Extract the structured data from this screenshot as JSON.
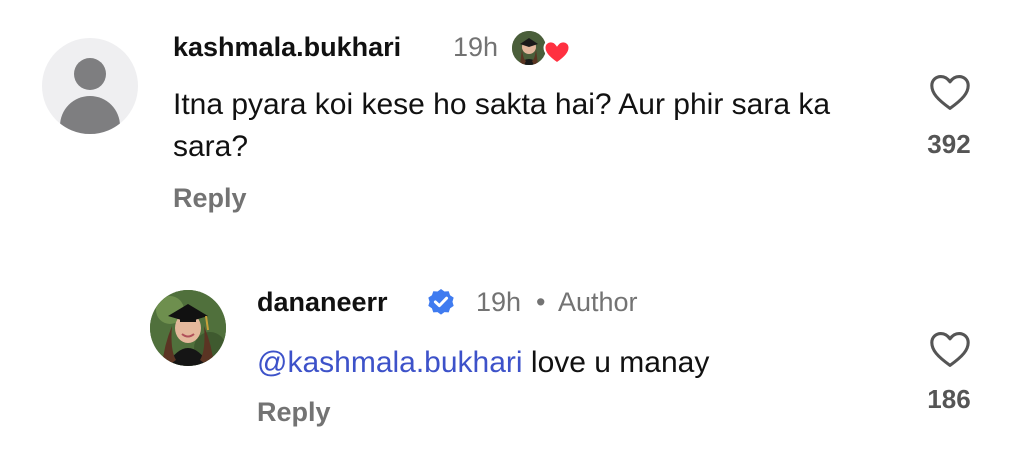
{
  "comments": [
    {
      "username": "kashmala.bukhari",
      "time": "19h",
      "text": "Itna pyara koi kese ho sakta hai? Aur phir sara ka sara?",
      "reply_label": "Reply",
      "likes": "392",
      "liked_by_author_icon": "author-avatar-with-heart"
    },
    {
      "username": "dananeerr",
      "time": "19h",
      "separator": "•",
      "author_label": "Author",
      "mention": "@kashmala.bukhari",
      "text": "love u manay",
      "reply_label": "Reply",
      "likes": "186",
      "verified_icon": "verified-badge-icon"
    }
  ],
  "colors": {
    "mention": "#3d52c9",
    "verified": "#3f7bf0",
    "heart": "#ff3040",
    "muted": "#737373"
  }
}
